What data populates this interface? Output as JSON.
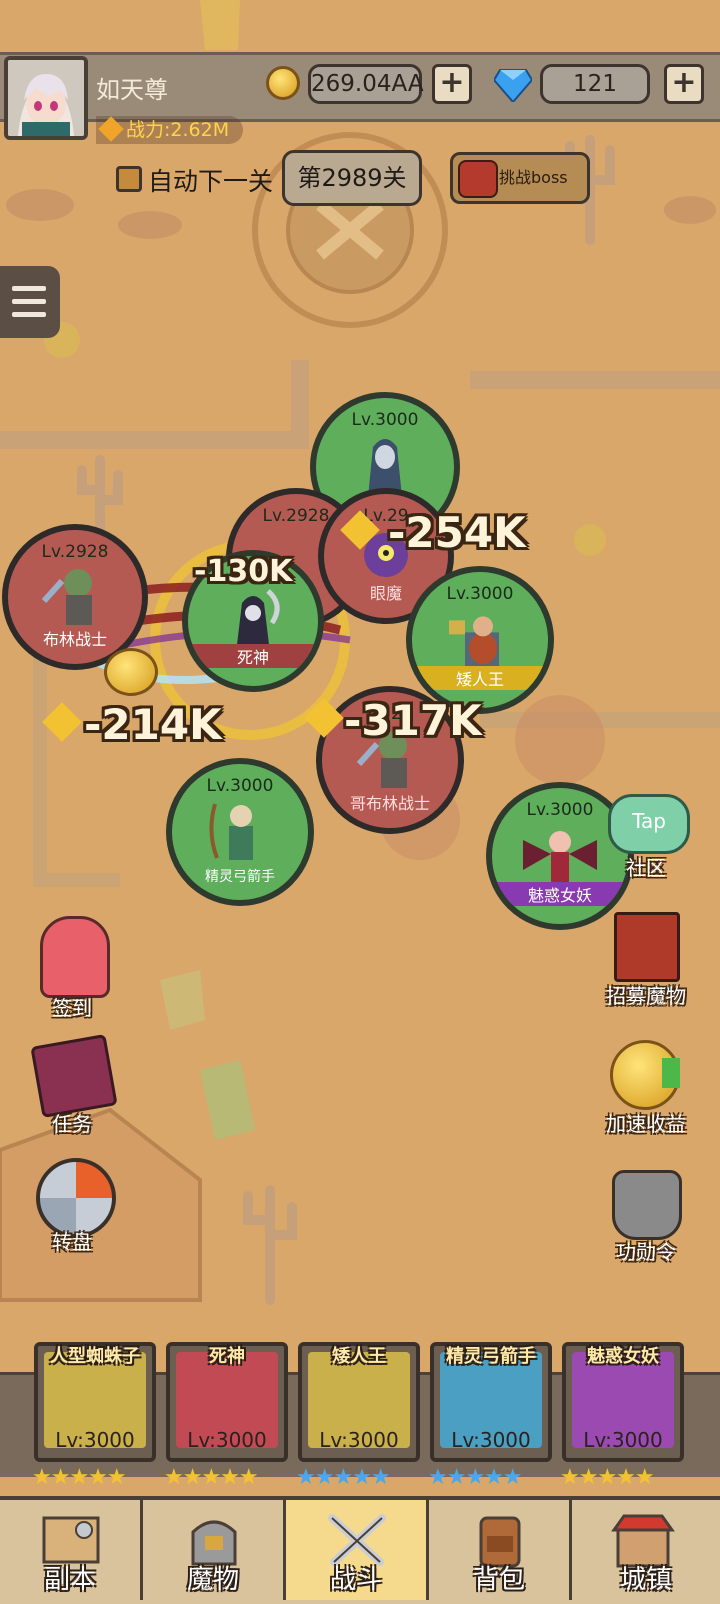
{
  "player": {
    "name": "如天尊",
    "power": "战力:2.62M",
    "gold": "269.04AA",
    "gems": "121"
  },
  "stage": {
    "auto_next_label": "自动下一关",
    "level_label": "第2989关",
    "boss_label": "挑战boss"
  },
  "monsters": [
    {
      "level": "Lv.3000",
      "name": "",
      "side": "ally"
    },
    {
      "level": "Lv.2928",
      "name": "",
      "side": "enemy"
    },
    {
      "level": "Lv.2928",
      "name": "布林战士",
      "side": "enemy"
    },
    {
      "level": "Lv.3000",
      "name": "死神",
      "side": "ally"
    },
    {
      "level": "Lv.29",
      "name": "眼魔",
      "side": "enemy"
    },
    {
      "level": "Lv.3000",
      "name": "矮人王",
      "side": "ally"
    },
    {
      "level": "Lv.29",
      "name": "哥布林战士",
      "side": "enemy"
    },
    {
      "level": "Lv.3000",
      "name": "精灵弓箭手",
      "side": "ally"
    },
    {
      "level": "Lv.3000",
      "name": "魅惑女妖",
      "side": "ally"
    }
  ],
  "damage_numbers": [
    "-254K",
    "-130K",
    "-214K",
    "-317K"
  ],
  "side_menu": {
    "community": "社区",
    "tap_badge": "Tap",
    "recruit": "招募魔物",
    "speed_income": "加速收益",
    "merit": "功勋令",
    "sign_in": "签到",
    "quests": "任务",
    "wheel": "转盘"
  },
  "roster": [
    {
      "name": "人型蜘蛛子",
      "level": "Lv:3000",
      "color": "#c9b04a",
      "stars": 5,
      "star_color": "#f3c232"
    },
    {
      "name": "死神",
      "level": "Lv:3000",
      "color": "#c24a55",
      "stars": 5,
      "star_color": "#f3c232"
    },
    {
      "name": "矮人王",
      "level": "Lv:3000",
      "color": "#c9b04a",
      "stars": 5,
      "star_color": "#4aa8e8"
    },
    {
      "name": "精灵弓箭手",
      "level": "Lv:3000",
      "color": "#4a9fc2",
      "stars": 5,
      "star_color": "#4aa8e8"
    },
    {
      "name": "魅惑女妖",
      "level": "Lv:3000",
      "color": "#9a4ab0",
      "stars": 5,
      "star_color": "#f3c232"
    }
  ],
  "tabs": [
    {
      "label": "副本",
      "icon": "map-icon"
    },
    {
      "label": "魔物",
      "icon": "helmet-icon"
    },
    {
      "label": "战斗",
      "icon": "crossed-swords-icon",
      "active": true
    },
    {
      "label": "背包",
      "icon": "backpack-icon"
    },
    {
      "label": "城镇",
      "icon": "shop-icon"
    }
  ]
}
